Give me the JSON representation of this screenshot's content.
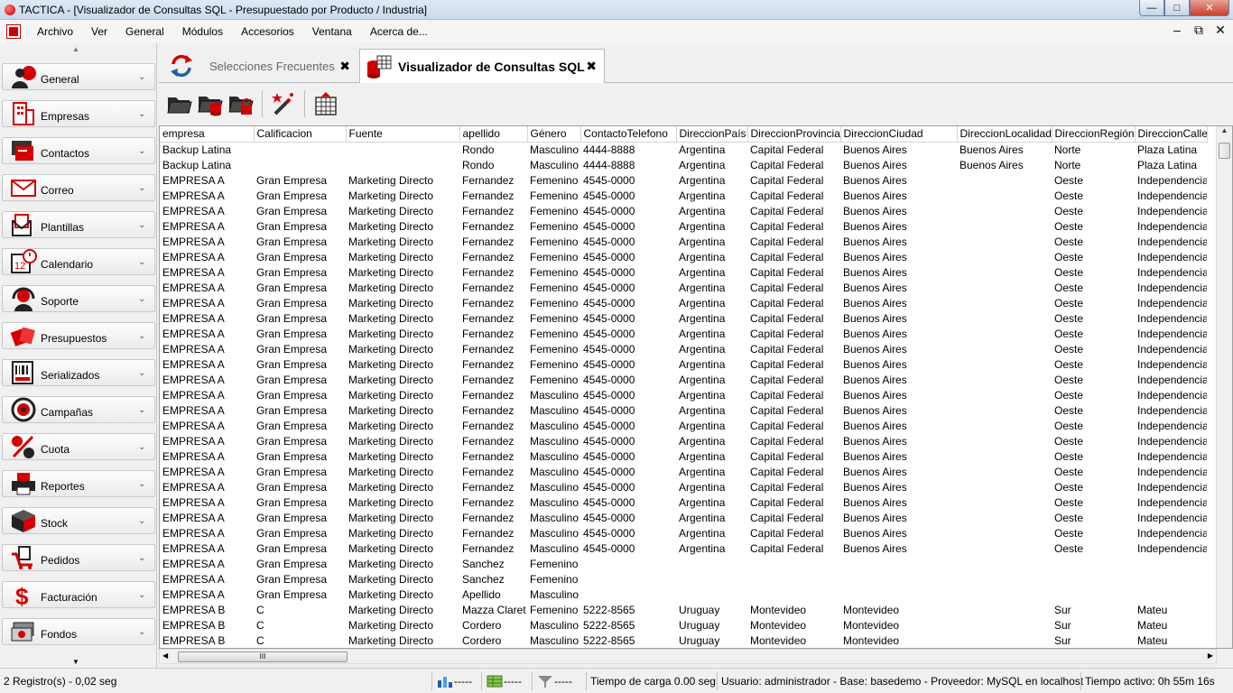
{
  "window": {
    "title": "TACTICA - [Visualizador de Consultas SQL - Presupuestado por Producto / Industria]",
    "minimize": "—",
    "maximize": "□",
    "close": "✕"
  },
  "menu": {
    "items": [
      "Archivo",
      "Ver",
      "General",
      "Módulos",
      "Accesorios",
      "Ventana",
      "Acerca de..."
    ],
    "mdi_min": "–",
    "mdi_restore": "⧉",
    "mdi_close": "✕"
  },
  "sidebar": {
    "items": [
      {
        "label": "General",
        "icon": "user-globe-icon"
      },
      {
        "label": "Empresas",
        "icon": "building-icon"
      },
      {
        "label": "Contactos",
        "icon": "contacts-icon"
      },
      {
        "label": "Correo",
        "icon": "envelope-icon"
      },
      {
        "label": "Plantillas",
        "icon": "template-icon"
      },
      {
        "label": "Calendario",
        "icon": "calendar-icon"
      },
      {
        "label": "Soporte",
        "icon": "headset-icon"
      },
      {
        "label": "Presupuestos",
        "icon": "quote-icon"
      },
      {
        "label": "Serializados",
        "icon": "barcode-icon"
      },
      {
        "label": "Campañas",
        "icon": "target-icon"
      },
      {
        "label": "Cuota",
        "icon": "percent-icon"
      },
      {
        "label": "Reportes",
        "icon": "printer-icon"
      },
      {
        "label": "Stock",
        "icon": "box-icon"
      },
      {
        "label": "Pedidos",
        "icon": "cart-icon"
      },
      {
        "label": "Facturación",
        "icon": "dollar-icon"
      },
      {
        "label": "Fondos",
        "icon": "money-icon"
      }
    ],
    "chevron": "⌄"
  },
  "tabs": [
    {
      "label": "Selecciones Frecuentes",
      "close": "✖",
      "active": false
    },
    {
      "label": "Visualizador de Consultas SQL",
      "close": "✖",
      "active": true
    }
  ],
  "toolbar": {
    "buttons": [
      "open-folder-icon",
      "open-db-icon",
      "open-locked-icon",
      "magic-wand-icon",
      "grid-export-icon"
    ]
  },
  "grid": {
    "columns": [
      "empresa",
      "Calificacion",
      "Fuente",
      "apellido",
      "Género",
      "ContactoTelefono",
      "DireccionPaís",
      "DireccionProvincia",
      "DireccionCiudad",
      "DireccionLocalidad",
      "DireccionRegión",
      "DireccionCalle"
    ],
    "rows": [
      [
        "Backup Latina",
        "",
        "",
        "Rondo",
        "Masculino",
        "4444-8888",
        "Argentina",
        "Capital Federal",
        "Buenos Aires",
        "Buenos Aires",
        "Norte",
        "Plaza Latina"
      ],
      [
        "Backup Latina",
        "",
        "",
        "Rondo",
        "Masculino",
        "4444-8888",
        "Argentina",
        "Capital Federal",
        "Buenos Aires",
        "Buenos Aires",
        "Norte",
        "Plaza Latina"
      ],
      [
        "EMPRESA A",
        "Gran Empresa",
        "Marketing Directo",
        "Fernandez",
        "Femenino",
        "4545-0000",
        "Argentina",
        "Capital Federal",
        "Buenos Aires",
        "",
        "Oeste",
        "Independencia"
      ],
      [
        "EMPRESA A",
        "Gran Empresa",
        "Marketing Directo",
        "Fernandez",
        "Femenino",
        "4545-0000",
        "Argentina",
        "Capital Federal",
        "Buenos Aires",
        "",
        "Oeste",
        "Independencia"
      ],
      [
        "EMPRESA A",
        "Gran Empresa",
        "Marketing Directo",
        "Fernandez",
        "Femenino",
        "4545-0000",
        "Argentina",
        "Capital Federal",
        "Buenos Aires",
        "",
        "Oeste",
        "Independencia"
      ],
      [
        "EMPRESA A",
        "Gran Empresa",
        "Marketing Directo",
        "Fernandez",
        "Femenino",
        "4545-0000",
        "Argentina",
        "Capital Federal",
        "Buenos Aires",
        "",
        "Oeste",
        "Independencia"
      ],
      [
        "EMPRESA A",
        "Gran Empresa",
        "Marketing Directo",
        "Fernandez",
        "Femenino",
        "4545-0000",
        "Argentina",
        "Capital Federal",
        "Buenos Aires",
        "",
        "Oeste",
        "Independencia"
      ],
      [
        "EMPRESA A",
        "Gran Empresa",
        "Marketing Directo",
        "Fernandez",
        "Femenino",
        "4545-0000",
        "Argentina",
        "Capital Federal",
        "Buenos Aires",
        "",
        "Oeste",
        "Independencia"
      ],
      [
        "EMPRESA A",
        "Gran Empresa",
        "Marketing Directo",
        "Fernandez",
        "Femenino",
        "4545-0000",
        "Argentina",
        "Capital Federal",
        "Buenos Aires",
        "",
        "Oeste",
        "Independencia"
      ],
      [
        "EMPRESA A",
        "Gran Empresa",
        "Marketing Directo",
        "Fernandez",
        "Femenino",
        "4545-0000",
        "Argentina",
        "Capital Federal",
        "Buenos Aires",
        "",
        "Oeste",
        "Independencia"
      ],
      [
        "EMPRESA A",
        "Gran Empresa",
        "Marketing Directo",
        "Fernandez",
        "Femenino",
        "4545-0000",
        "Argentina",
        "Capital Federal",
        "Buenos Aires",
        "",
        "Oeste",
        "Independencia"
      ],
      [
        "EMPRESA A",
        "Gran Empresa",
        "Marketing Directo",
        "Fernandez",
        "Femenino",
        "4545-0000",
        "Argentina",
        "Capital Federal",
        "Buenos Aires",
        "",
        "Oeste",
        "Independencia"
      ],
      [
        "EMPRESA A",
        "Gran Empresa",
        "Marketing Directo",
        "Fernandez",
        "Femenino",
        "4545-0000",
        "Argentina",
        "Capital Federal",
        "Buenos Aires",
        "",
        "Oeste",
        "Independencia"
      ],
      [
        "EMPRESA A",
        "Gran Empresa",
        "Marketing Directo",
        "Fernandez",
        "Femenino",
        "4545-0000",
        "Argentina",
        "Capital Federal",
        "Buenos Aires",
        "",
        "Oeste",
        "Independencia"
      ],
      [
        "EMPRESA A",
        "Gran Empresa",
        "Marketing Directo",
        "Fernandez",
        "Femenino",
        "4545-0000",
        "Argentina",
        "Capital Federal",
        "Buenos Aires",
        "",
        "Oeste",
        "Independencia"
      ],
      [
        "EMPRESA A",
        "Gran Empresa",
        "Marketing Directo",
        "Fernandez",
        "Femenino",
        "4545-0000",
        "Argentina",
        "Capital Federal",
        "Buenos Aires",
        "",
        "Oeste",
        "Independencia"
      ],
      [
        "EMPRESA A",
        "Gran Empresa",
        "Marketing Directo",
        "Fernandez",
        "Masculino",
        "4545-0000",
        "Argentina",
        "Capital Federal",
        "Buenos Aires",
        "",
        "Oeste",
        "Independencia"
      ],
      [
        "EMPRESA A",
        "Gran Empresa",
        "Marketing Directo",
        "Fernandez",
        "Masculino",
        "4545-0000",
        "Argentina",
        "Capital Federal",
        "Buenos Aires",
        "",
        "Oeste",
        "Independencia"
      ],
      [
        "EMPRESA A",
        "Gran Empresa",
        "Marketing Directo",
        "Fernandez",
        "Masculino",
        "4545-0000",
        "Argentina",
        "Capital Federal",
        "Buenos Aires",
        "",
        "Oeste",
        "Independencia"
      ],
      [
        "EMPRESA A",
        "Gran Empresa",
        "Marketing Directo",
        "Fernandez",
        "Masculino",
        "4545-0000",
        "Argentina",
        "Capital Federal",
        "Buenos Aires",
        "",
        "Oeste",
        "Independencia"
      ],
      [
        "EMPRESA A",
        "Gran Empresa",
        "Marketing Directo",
        "Fernandez",
        "Masculino",
        "4545-0000",
        "Argentina",
        "Capital Federal",
        "Buenos Aires",
        "",
        "Oeste",
        "Independencia"
      ],
      [
        "EMPRESA A",
        "Gran Empresa",
        "Marketing Directo",
        "Fernandez",
        "Masculino",
        "4545-0000",
        "Argentina",
        "Capital Federal",
        "Buenos Aires",
        "",
        "Oeste",
        "Independencia"
      ],
      [
        "EMPRESA A",
        "Gran Empresa",
        "Marketing Directo",
        "Fernandez",
        "Masculino",
        "4545-0000",
        "Argentina",
        "Capital Federal",
        "Buenos Aires",
        "",
        "Oeste",
        "Independencia"
      ],
      [
        "EMPRESA A",
        "Gran Empresa",
        "Marketing Directo",
        "Fernandez",
        "Masculino",
        "4545-0000",
        "Argentina",
        "Capital Federal",
        "Buenos Aires",
        "",
        "Oeste",
        "Independencia"
      ],
      [
        "EMPRESA A",
        "Gran Empresa",
        "Marketing Directo",
        "Fernandez",
        "Masculino",
        "4545-0000",
        "Argentina",
        "Capital Federal",
        "Buenos Aires",
        "",
        "Oeste",
        "Independencia"
      ],
      [
        "EMPRESA A",
        "Gran Empresa",
        "Marketing Directo",
        "Fernandez",
        "Masculino",
        "4545-0000",
        "Argentina",
        "Capital Federal",
        "Buenos Aires",
        "",
        "Oeste",
        "Independencia"
      ],
      [
        "EMPRESA A",
        "Gran Empresa",
        "Marketing Directo",
        "Fernandez",
        "Masculino",
        "4545-0000",
        "Argentina",
        "Capital Federal",
        "Buenos Aires",
        "",
        "Oeste",
        "Independencia"
      ],
      [
        "EMPRESA A",
        "Gran Empresa",
        "Marketing Directo",
        "Sanchez",
        "Femenino",
        "",
        "",
        "",
        "",
        "",
        "",
        ""
      ],
      [
        "EMPRESA A",
        "Gran Empresa",
        "Marketing Directo",
        "Sanchez",
        "Femenino",
        "",
        "",
        "",
        "",
        "",
        "",
        ""
      ],
      [
        "EMPRESA A",
        "Gran Empresa",
        "Marketing Directo",
        "Apellido",
        "Masculino",
        "",
        "",
        "",
        "",
        "",
        "",
        ""
      ],
      [
        "EMPRESA B",
        "C",
        "Marketing Directo",
        "Mazza Claret",
        "Femenino",
        "5222-8565",
        "Uruguay",
        "Montevideo",
        "Montevideo",
        "",
        "Sur",
        "Mateu"
      ],
      [
        "EMPRESA B",
        "C",
        "Marketing Directo",
        "Cordero",
        "Masculino",
        "5222-8565",
        "Uruguay",
        "Montevideo",
        "Montevideo",
        "",
        "Sur",
        "Mateu"
      ],
      [
        "EMPRESA B",
        "C",
        "Marketing Directo",
        "Cordero",
        "Masculino",
        "5222-8565",
        "Uruguay",
        "Montevideo",
        "Montevideo",
        "",
        "Sur",
        "Mateu"
      ],
      [
        "EMPRESA B",
        "C",
        "Marketing Directo",
        "Cordero",
        "Masculino",
        "5222-8565",
        "Uruguay",
        "Montevideo",
        "Montevideo",
        "",
        "Sur",
        "Mateu"
      ]
    ]
  },
  "scroll": {
    "up": "▲",
    "down": "▼",
    "left": "◀",
    "right": "▶",
    "grip": "III"
  },
  "status": {
    "records": "2 Registro(s) - 0,02 seg",
    "seg1": "-----",
    "seg2": "-----",
    "seg3": "-----",
    "load_time": "Tiempo de carga 0.00 seg",
    "user_info": "Usuario: administrador - Base: basedemo - Proveedor: MySQL en localhost",
    "active_time": "Tiempo activo: 0h 55m 16s"
  },
  "colors": {
    "brand_red": "#d40000",
    "accent_blue": "#1e5fa8"
  }
}
